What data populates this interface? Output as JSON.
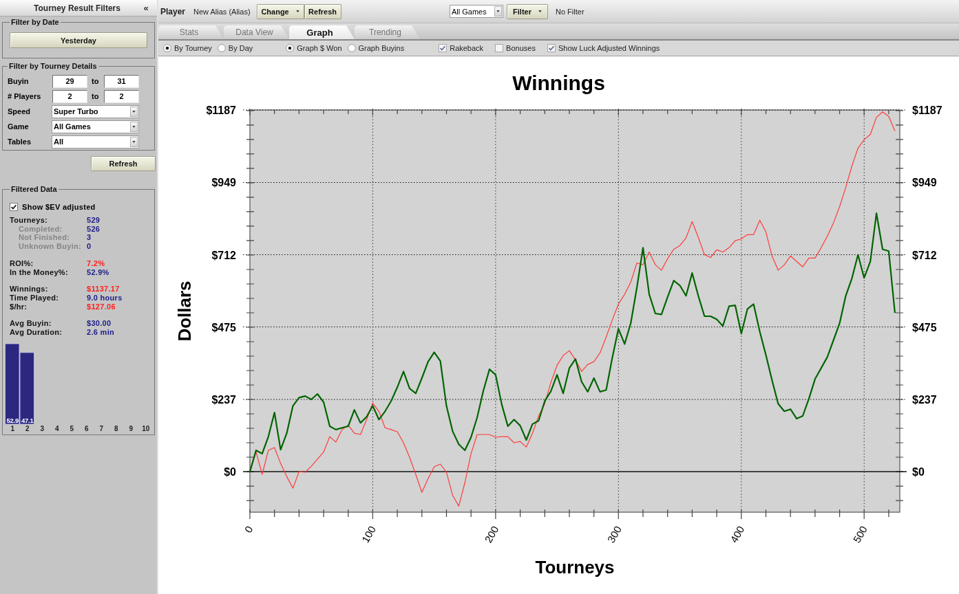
{
  "sidebar": {
    "title": "Tourney Result Filters",
    "collapse_glyph": "«",
    "date_filter": {
      "legend": "Filter by Date",
      "button": "Yesterday"
    },
    "details_filter": {
      "legend": "Filter by Tourney Details",
      "rows": [
        {
          "kind": "range",
          "label": "Buyin",
          "from": "29",
          "separator": "to",
          "to": "31"
        },
        {
          "kind": "range",
          "label": "# Players",
          "from": "2",
          "separator": "to",
          "to": "2"
        },
        {
          "kind": "select",
          "label": "Speed",
          "value": "Super Turbo"
        },
        {
          "kind": "select",
          "label": "Game",
          "value": "All Games"
        },
        {
          "kind": "select",
          "label": "Tables",
          "value": "All"
        }
      ]
    },
    "refresh_button": "Refresh",
    "filtered_data": {
      "legend": "Filtered Data",
      "ev_checkbox": {
        "label": "Show $EV adjusted",
        "checked": true
      },
      "groups": [
        [
          {
            "label": "Tourneys:",
            "value": "529",
            "color": "#1c1c8a",
            "children": [
              {
                "label": "Completed:",
                "value": "526",
                "color": "#1c1c8a"
              },
              {
                "label": "Not Finished:",
                "value": "3",
                "color": "#1c1c8a"
              },
              {
                "label": "Unknown Buyin:",
                "value": "0",
                "color": "#1c1c8a"
              }
            ]
          }
        ],
        [
          {
            "label": "ROI%:",
            "value": "7.2%",
            "color": "#ff2020"
          },
          {
            "label": "In the Money%:",
            "value": "52.9%",
            "color": "#1c1c8a"
          }
        ],
        [
          {
            "label": "Winnings:",
            "value": "$1137.17",
            "color": "#ff2020"
          },
          {
            "label": "Time Played:",
            "value": "9.0 hours",
            "color": "#1c1c8a"
          },
          {
            "label": "$/hr:",
            "value": "$127.06",
            "color": "#ff2020"
          }
        ],
        [
          {
            "label": "Avg Buyin:",
            "value": "$30.00",
            "color": "#1c1c8a"
          },
          {
            "label": "Avg Duration:",
            "value": "2.6 min",
            "color": "#1c1c8a"
          }
        ]
      ],
      "chart_data": {
        "type": "bar",
        "categories": [
          "1",
          "2",
          "3",
          "4",
          "5",
          "6",
          "7",
          "8",
          "9",
          "10"
        ],
        "values": [
          52.9,
          47.1,
          0,
          0,
          0,
          0,
          0,
          0,
          0,
          0
        ],
        "value_labels": [
          "52.9",
          "47.1",
          null,
          null,
          null,
          null,
          null,
          null,
          null,
          null
        ]
      }
    }
  },
  "toolbar": {
    "player_label": "Player",
    "player_name": "New Alias (Alias)",
    "change_button": "Change",
    "refresh_button": "Refresh",
    "game_select": "All Games",
    "filter_button": "Filter",
    "filter_status": "No Filter"
  },
  "tabs": [
    {
      "label": "Stats",
      "selected": false
    },
    {
      "label": "Data View",
      "selected": false
    },
    {
      "label": "Graph",
      "selected": true
    },
    {
      "label": "Trending",
      "selected": false
    }
  ],
  "view_options": {
    "radio_groups": [
      [
        {
          "label": "By Tourney",
          "selected": true
        },
        {
          "label": "By Day",
          "selected": false
        }
      ],
      [
        {
          "label": "Graph $ Won",
          "selected": true
        },
        {
          "label": "Graph Buyins",
          "selected": false
        }
      ]
    ],
    "checkboxes": [
      {
        "label": "Rakeback",
        "checked": true
      },
      {
        "label": "Bonuses",
        "checked": false
      },
      {
        "label": "Show Luck Adjusted Winnings",
        "checked": true
      }
    ]
  },
  "graph": {
    "chart_data": {
      "type": "line",
      "title": "Winnings",
      "xlabel": "Tourneys",
      "ylabel": "Dollars",
      "x": [
        0,
        5,
        10,
        15,
        20,
        25,
        30,
        35,
        40,
        45,
        50,
        55,
        60,
        65,
        70,
        75,
        80,
        85,
        90,
        95,
        100,
        105,
        110,
        115,
        120,
        125,
        130,
        135,
        140,
        145,
        150,
        155,
        160,
        165,
        170,
        175,
        180,
        185,
        190,
        195,
        200,
        205,
        210,
        215,
        220,
        225,
        230,
        235,
        240,
        245,
        250,
        255,
        260,
        265,
        270,
        275,
        280,
        285,
        290,
        295,
        300,
        305,
        310,
        315,
        320,
        325,
        330,
        335,
        340,
        345,
        350,
        355,
        360,
        365,
        370,
        375,
        380,
        385,
        390,
        395,
        400,
        405,
        410,
        415,
        420,
        425,
        430,
        435,
        440,
        445,
        450,
        455,
        460,
        465,
        470,
        475,
        480,
        485,
        490,
        495,
        500,
        505,
        510,
        515,
        520,
        525
      ],
      "series": [
        {
          "color": "#ff3b3b",
          "values": [
            0,
            65,
            -9,
            70,
            79,
            27,
            -16,
            -54,
            0,
            -2,
            18,
            41,
            65,
            115,
            97,
            138,
            153,
            126,
            122,
            171,
            225,
            198,
            144,
            138,
            131,
            95,
            47,
            -9,
            -68,
            -23,
            16,
            25,
            -2,
            -77,
            -113,
            -36,
            59,
            122,
            122,
            122,
            113,
            115,
            115,
            95,
            99,
            81,
            126,
            183,
            223,
            293,
            349,
            381,
            397,
            367,
            329,
            352,
            361,
            390,
            442,
            498,
            550,
            582,
            622,
            685,
            679,
            721,
            679,
            661,
            699,
            730,
            742,
            767,
            821,
            769,
            712,
            703,
            728,
            721,
            735,
            758,
            764,
            778,
            778,
            825,
            787,
            708,
            661,
            679,
            708,
            690,
            672,
            701,
            701,
            735,
            773,
            816,
            870,
            933,
            1003,
            1062,
            1089,
            1107,
            1163,
            1181,
            1166,
            1118
          ]
        },
        {
          "color": "#006400",
          "values": [
            0,
            70,
            59,
            115,
            194,
            72,
            126,
            216,
            243,
            248,
            237,
            255,
            228,
            149,
            138,
            144,
            149,
            203,
            160,
            180,
            216,
            171,
            198,
            232,
            277,
            329,
            273,
            257,
            307,
            361,
            392,
            363,
            216,
            133,
            90,
            70,
            113,
            178,
            266,
            336,
            318,
            221,
            149,
            171,
            151,
            104,
            156,
            167,
            232,
            264,
            318,
            257,
            340,
            370,
            295,
            262,
            307,
            262,
            268,
            374,
            469,
            419,
            487,
            604,
            735,
            582,
            519,
            516,
            573,
            627,
            611,
            577,
            652,
            577,
            510,
            510,
            500,
            478,
            543,
            546,
            453,
            534,
            550,
            460,
            383,
            300,
            223,
            198,
            205,
            174,
            183,
            239,
            304,
            340,
            376,
            431,
            487,
            577,
            634,
            712,
            636,
            690,
            848,
            730,
            724,
            521
          ]
        }
      ],
      "xlim": [
        0,
        529
      ],
      "ylim": [
        -133,
        1187
      ],
      "y2lim": [
        -133,
        1187
      ],
      "grid": true,
      "xticks": [
        0,
        100,
        200,
        300,
        400,
        500
      ],
      "yticks": [
        {
          "value": 0,
          "label": "$0"
        },
        {
          "value": 237,
          "label": "$237"
        },
        {
          "value": 475,
          "label": "$475"
        },
        {
          "value": 712,
          "label": "$712"
        },
        {
          "value": 949,
          "label": "$949"
        },
        {
          "value": 1187,
          "label": "$1187"
        }
      ],
      "y2ticks": [
        {
          "value": 0,
          "label": "$0"
        },
        {
          "value": 237,
          "label": "$237"
        },
        {
          "value": 475,
          "label": "$475"
        },
        {
          "value": 712,
          "label": "$712"
        },
        {
          "value": 949,
          "label": "$949"
        },
        {
          "value": 1187,
          "label": "$1187"
        }
      ]
    }
  }
}
